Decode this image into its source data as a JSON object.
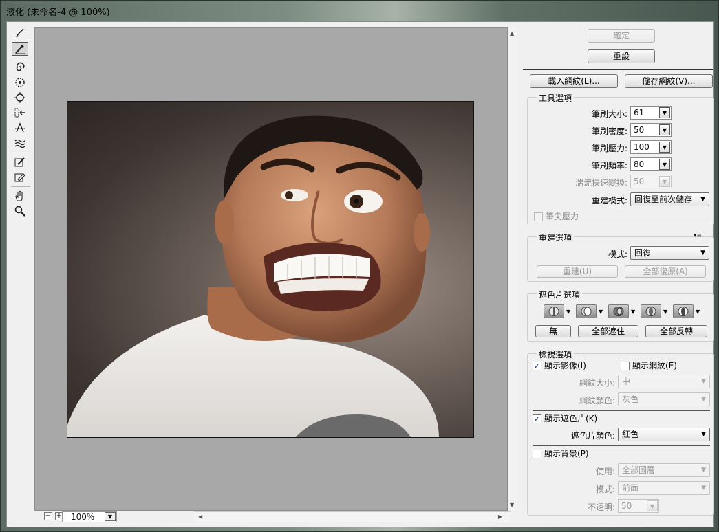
{
  "window": {
    "title": "液化 (未命名-4 @ 100%)"
  },
  "toolbar": {
    "tools": [
      {
        "icon": "forward-warp-icon"
      },
      {
        "icon": "reconstruct-icon"
      },
      {
        "icon": "twirl-clockwise-icon"
      },
      {
        "icon": "pucker-icon"
      },
      {
        "icon": "bloat-icon"
      },
      {
        "icon": "push-left-icon"
      },
      {
        "icon": "mirror-icon"
      },
      {
        "icon": "turbulence-icon"
      },
      {
        "icon": "freeze-mask-icon"
      },
      {
        "icon": "thaw-mask-icon"
      },
      {
        "icon": "hand-icon"
      },
      {
        "icon": "zoom-icon"
      }
    ]
  },
  "statusbar": {
    "zoom_value": "100%"
  },
  "actions": {
    "ok": "確定",
    "reset": "重設",
    "load_mesh": "載入網紋(L)...",
    "save_mesh": "儲存網紋(V)..."
  },
  "tool_options": {
    "title": "工具選項",
    "brush_size_label": "筆刷大小:",
    "brush_size": "61",
    "brush_density_label": "筆刷密度:",
    "brush_density": "50",
    "brush_pressure_label": "筆刷壓力:",
    "brush_pressure": "100",
    "brush_rate_label": "筆刷頻率:",
    "brush_rate": "80",
    "turbulent_jitter_label": "湍流快速變換:",
    "turbulent_jitter": "50",
    "reconstruct_mode_label": "重建模式:",
    "reconstruct_mode": "回復至前次儲存",
    "stylus_pressure": "筆尖壓力"
  },
  "reconstruct_options": {
    "title": "重建選項",
    "mode_label": "模式:",
    "mode": "回復",
    "reconstruct_button": "重建(U)",
    "restore_all_button": "全部復原(A)"
  },
  "mask_options": {
    "title": "遮色片選項",
    "none_button": "無",
    "mask_all_button": "全部遮住",
    "invert_all_button": "全部反轉"
  },
  "view_options": {
    "title": "檢視選項",
    "show_image": "顯示影像(I)",
    "show_mesh": "顯示網紋(E)",
    "mesh_size_label": "網紋大小:",
    "mesh_size": "中",
    "mesh_color_label": "網紋顏色:",
    "mesh_color": "灰色",
    "show_mask": "顯示遮色片(K)",
    "mask_color_label": "遮色片顏色:",
    "mask_color": "紅色",
    "show_backdrop": "顯示背景(P)",
    "use_label": "使用:",
    "use_value": "全部圖層",
    "mode_label": "模式:",
    "mode_value": "前面",
    "opacity_label": "不透明:",
    "opacity_value": "50"
  }
}
